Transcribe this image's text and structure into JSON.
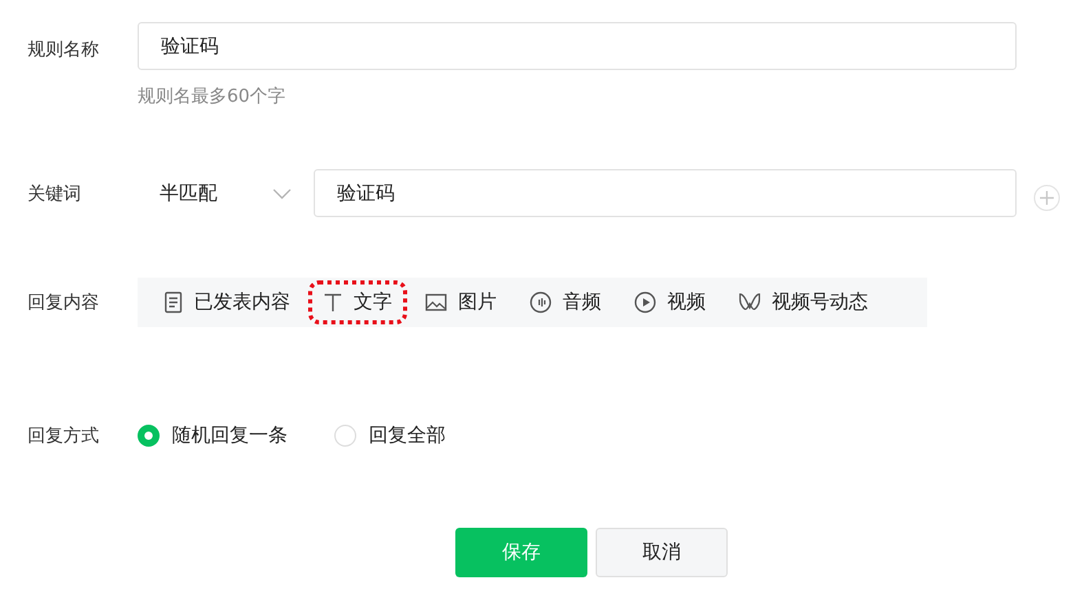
{
  "rule_name": {
    "label": "规则名称",
    "value": "验证码",
    "hint": "规则名最多60个字"
  },
  "keyword": {
    "label": "关键词",
    "match": "半匹配",
    "value": "验证码"
  },
  "reply_content": {
    "label": "回复内容",
    "types": [
      {
        "kind": "article",
        "label": "已发表内容",
        "highlighted": false
      },
      {
        "kind": "text",
        "label": "文字",
        "highlighted": true
      },
      {
        "kind": "image",
        "label": "图片",
        "highlighted": false
      },
      {
        "kind": "audio",
        "label": "音频",
        "highlighted": false
      },
      {
        "kind": "video",
        "label": "视频",
        "highlighted": false
      },
      {
        "kind": "channels",
        "label": "视频号动态",
        "highlighted": false
      }
    ]
  },
  "reply_method": {
    "label": "回复方式",
    "options": [
      {
        "label": "随机回复一条",
        "selected": true
      },
      {
        "label": "回复全部",
        "selected": false
      }
    ]
  },
  "buttons": [
    {
      "kind": "primary",
      "label": "保存"
    },
    {
      "kind": "default",
      "label": "取消"
    }
  ]
}
